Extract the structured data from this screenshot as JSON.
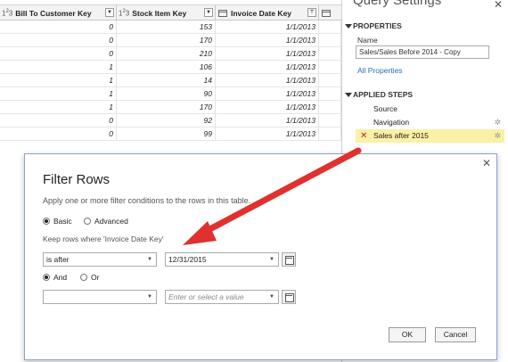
{
  "grid": {
    "columns": [
      {
        "label": "Bill To Customer Key",
        "type_icon": "1²3"
      },
      {
        "label": "Stock Item Key",
        "type_icon": "1²3"
      },
      {
        "label": "Invoice Date Key",
        "type_icon": "calendar-icon"
      }
    ],
    "rows": [
      [
        "0",
        "153",
        "1/1/2013"
      ],
      [
        "0",
        "170",
        "1/1/2013"
      ],
      [
        "0",
        "210",
        "1/1/2013"
      ],
      [
        "1",
        "106",
        "1/1/2013"
      ],
      [
        "1",
        "14",
        "1/1/2013"
      ],
      [
        "1",
        "90",
        "1/1/2013"
      ],
      [
        "1",
        "170",
        "1/1/2013"
      ],
      [
        "0",
        "92",
        "1/1/2013"
      ],
      [
        "0",
        "99",
        "1/1/2013"
      ]
    ]
  },
  "query_settings": {
    "title": "Query Settings",
    "properties_header": "PROPERTIES",
    "name_label": "Name",
    "name_value": "Sales/Sales Before 2014 - Copy",
    "all_properties": "All Properties",
    "applied_steps_header": "APPLIED STEPS",
    "steps": [
      "Source",
      "Navigation",
      "Sales after 2015"
    ]
  },
  "dialog": {
    "title": "Filter Rows",
    "description": "Apply one or more filter conditions to the rows in this table.",
    "basic_label": "Basic",
    "advanced_label": "Advanced",
    "keep_rows_label": "Keep rows where 'Invoice Date Key'",
    "operator1": "is after",
    "value1": "12/31/2015",
    "and_label": "And",
    "or_label": "Or",
    "operator2": "",
    "value2_placeholder": "Enter or select a value",
    "ok_label": "OK",
    "cancel_label": "Cancel"
  },
  "colors": {
    "arrow": "#e0312f",
    "active_step": "#f9f1a5",
    "link": "#2b6fb8"
  }
}
